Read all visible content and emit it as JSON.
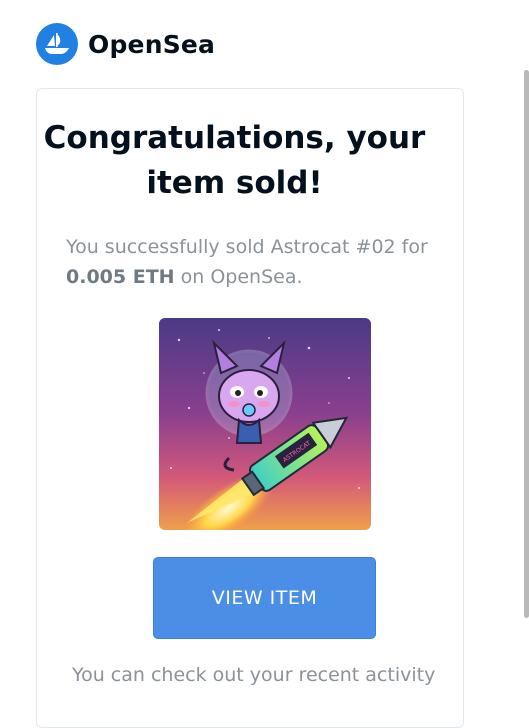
{
  "brand": {
    "name": "OpenSea",
    "logo_icon": "boat-icon",
    "color": "#2081E2"
  },
  "card": {
    "title_line1": "Congratulations, your",
    "title_line2": "item sold!",
    "desc_prefix": "You successfully sold Astrocat #02 for",
    "desc_amount": "0.005 ETH",
    "desc_suffix": "on OpenSea.",
    "image_alt": "Astrocat #02 riding a rocket in space",
    "image_sign_text": "ASTROCAT",
    "button_label": "VIEW ITEM",
    "footer_text": "You can check out your recent activity"
  },
  "colors": {
    "button": "#4a8ee6",
    "heading": "#04111D",
    "muted": "#8a939b"
  }
}
